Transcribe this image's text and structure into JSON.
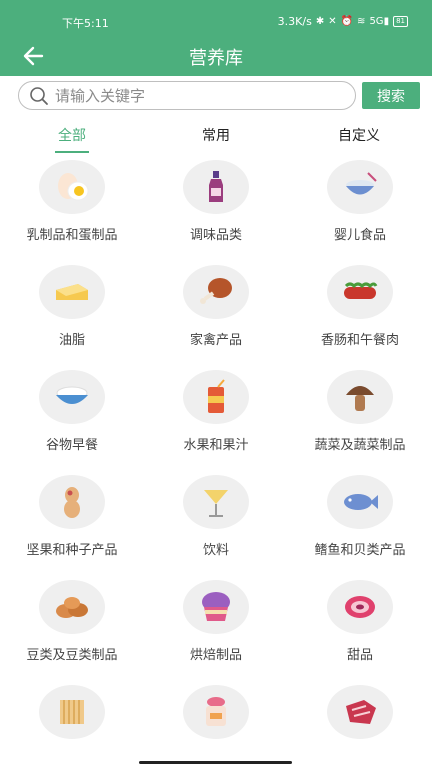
{
  "status_bar": {
    "time": "下午5:11",
    "speed": "3.3K/s",
    "battery": "81",
    "signal": "5G",
    "icons": [
      "bluetooth-icon",
      "mute-icon",
      "alarm-icon",
      "wifi-icon",
      "signal-icon",
      "battery-icon"
    ]
  },
  "header": {
    "title": "营养库",
    "back_icon": "arrow-left-icon"
  },
  "search": {
    "placeholder": "请输入关键字",
    "value": "",
    "button_label": "搜索"
  },
  "tabs": [
    {
      "label": "全部",
      "active": true
    },
    {
      "label": "常用",
      "active": false
    },
    {
      "label": "自定义",
      "active": false
    }
  ],
  "categories": [
    {
      "label": "乳制品和蛋制品",
      "icon": "egg-icon"
    },
    {
      "label": "调味品类",
      "icon": "sauce-bottle-icon"
    },
    {
      "label": "婴儿食品",
      "icon": "baby-food-bowl-icon"
    },
    {
      "label": "油脂",
      "icon": "butter-icon"
    },
    {
      "label": "家禽产品",
      "icon": "drumstick-icon"
    },
    {
      "label": "香肠和午餐肉",
      "icon": "sausage-icon"
    },
    {
      "label": "谷物早餐",
      "icon": "cereal-bowl-icon"
    },
    {
      "label": "水果和果汁",
      "icon": "juice-can-icon"
    },
    {
      "label": "蔬菜及蔬菜制品",
      "icon": "mushroom-icon"
    },
    {
      "label": "坚果和种子产品",
      "icon": "peanut-icon"
    },
    {
      "label": "饮料",
      "icon": "cocktail-glass-icon"
    },
    {
      "label": "鳍鱼和贝类产品",
      "icon": "fish-icon"
    },
    {
      "label": "豆类及豆类制品",
      "icon": "beans-icon"
    },
    {
      "label": "烘焙制品",
      "icon": "cupcake-icon"
    },
    {
      "label": "甜品",
      "icon": "sweet-roll-icon"
    },
    {
      "label": "",
      "icon": "noodles-icon"
    },
    {
      "label": "",
      "icon": "jar-icon"
    },
    {
      "label": "",
      "icon": "meat-icon"
    }
  ],
  "colors": {
    "primary": "#4caf7d",
    "circle_bg": "#efefef",
    "text": "#444444"
  }
}
